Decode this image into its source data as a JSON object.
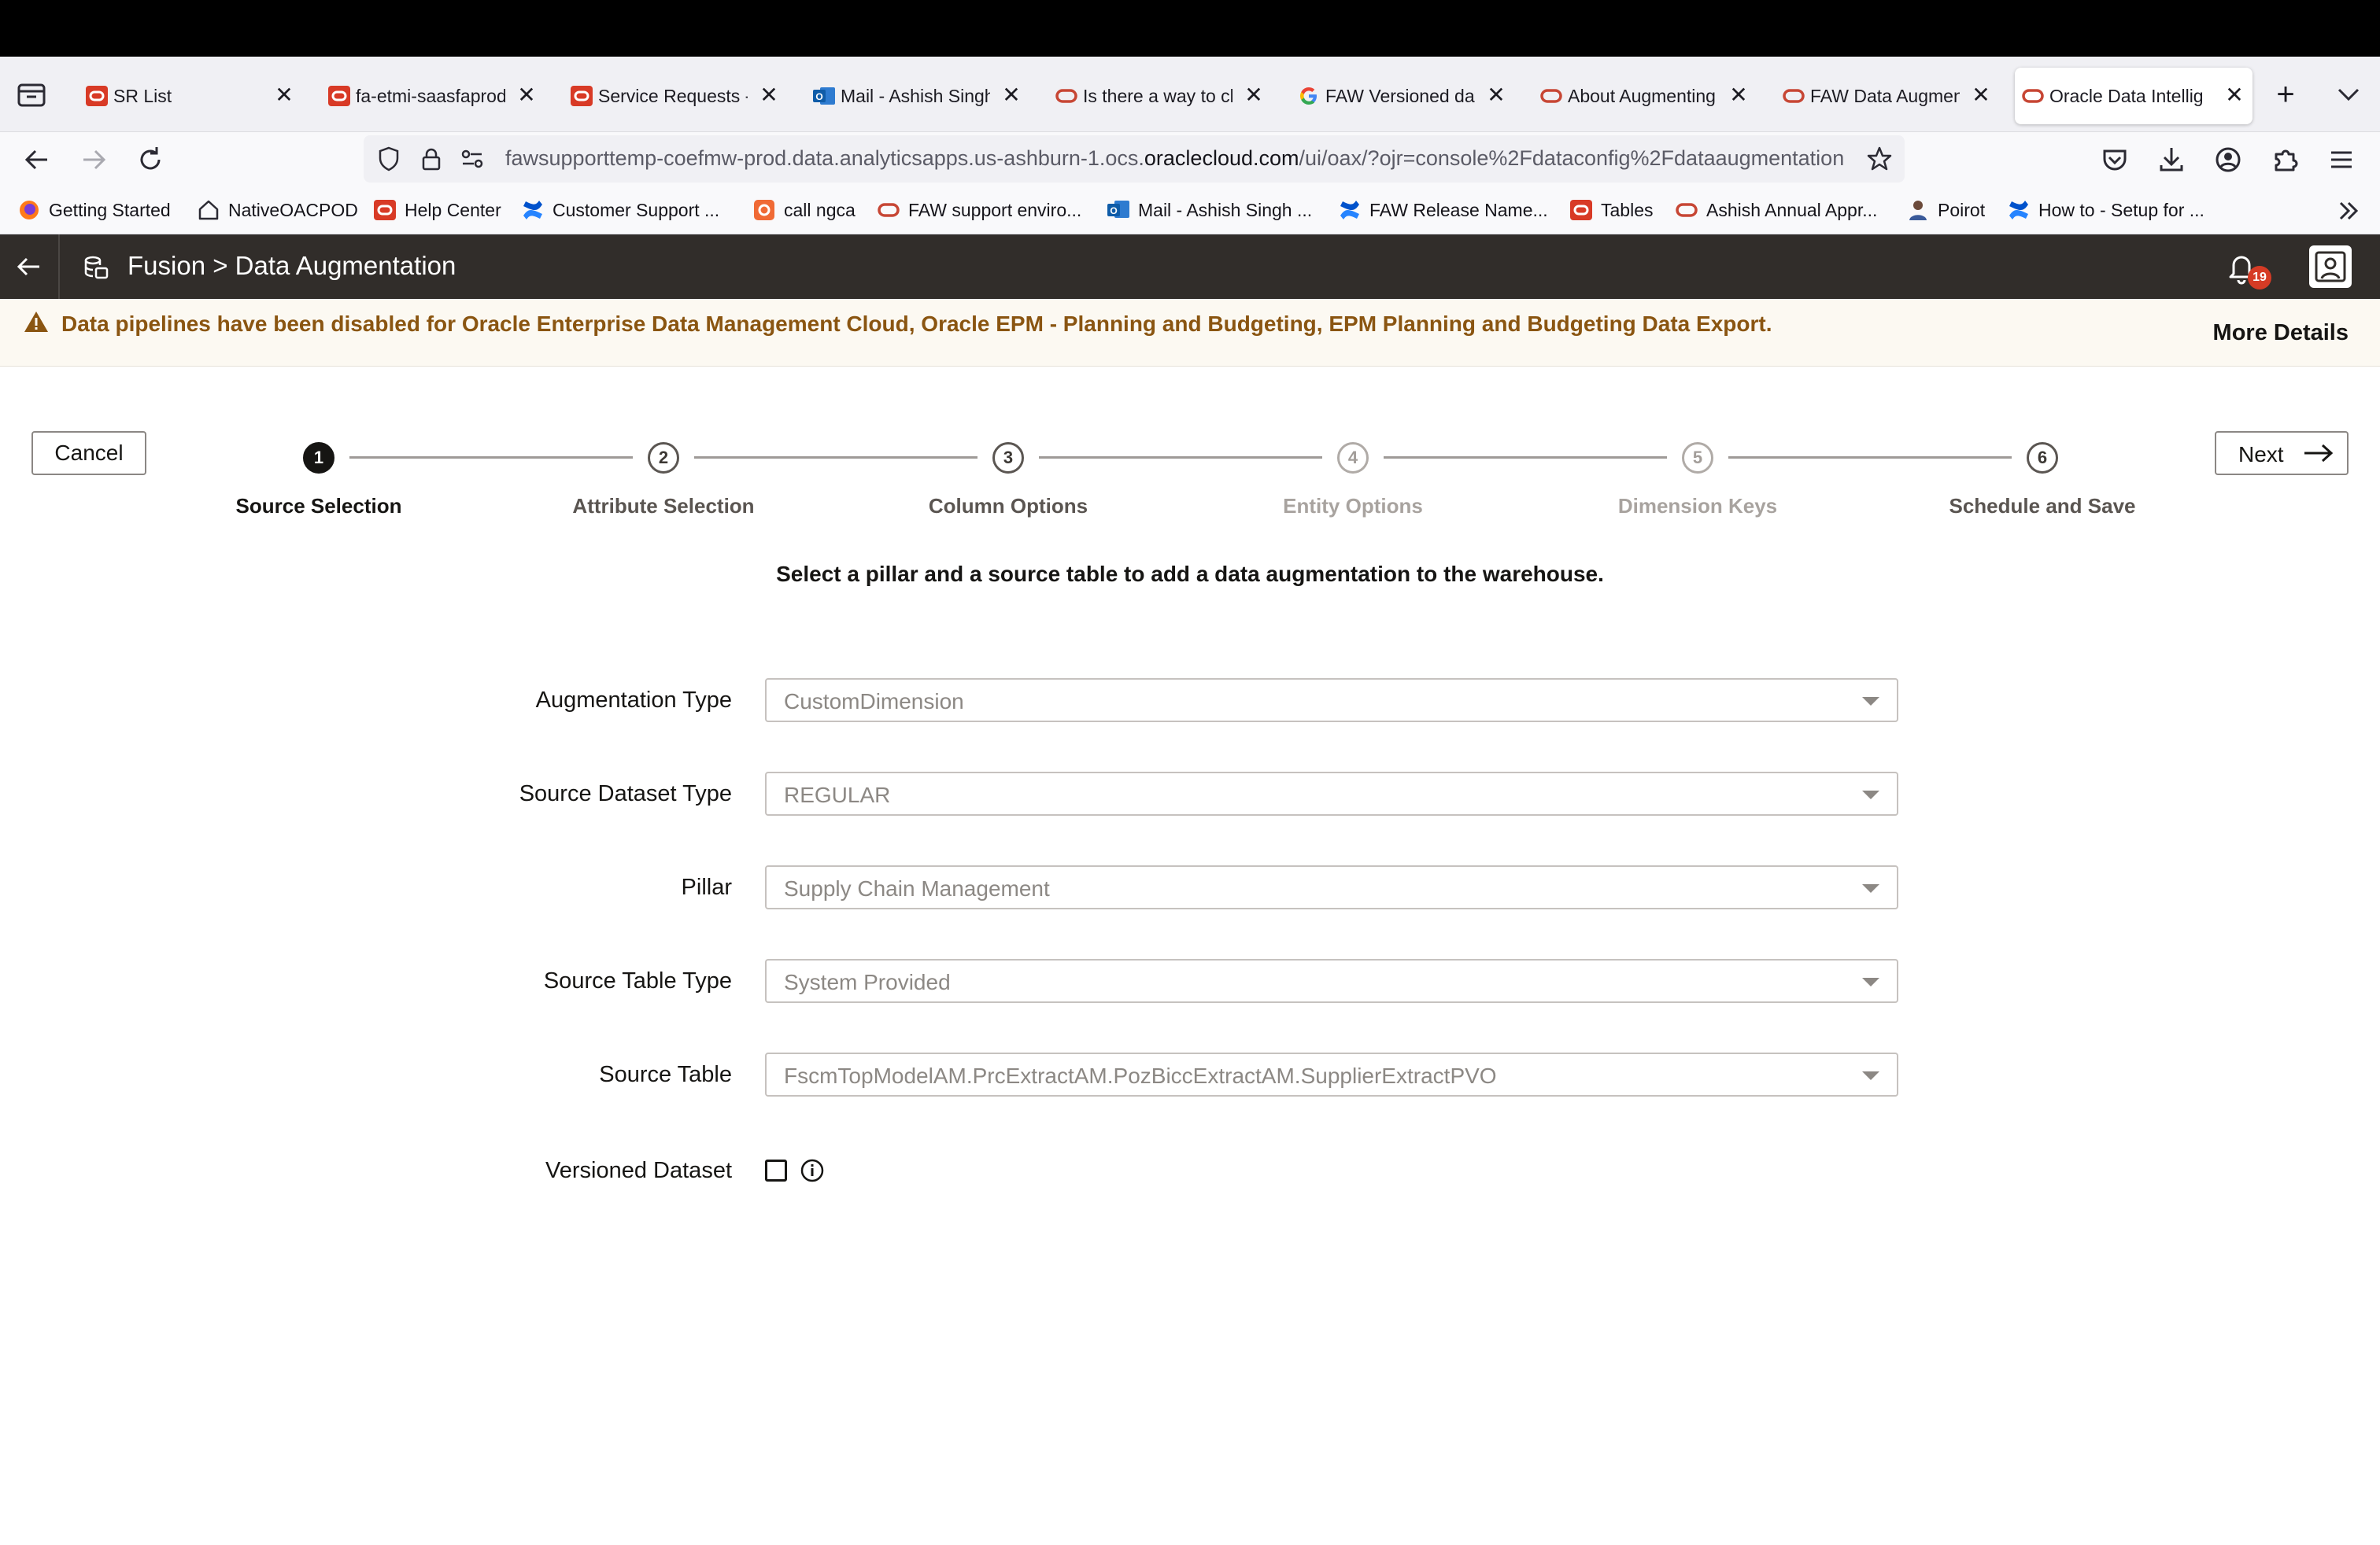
{
  "browser": {
    "tabs": [
      {
        "title": "SR List",
        "favicon": "oracle-square-icon",
        "active": false
      },
      {
        "title": "fa-etmi-saasfaprod",
        "favicon": "oracle-square-icon",
        "active": false
      },
      {
        "title": "Service Requests -",
        "favicon": "oracle-square-icon",
        "active": false
      },
      {
        "title": "Mail - Ashish Singh",
        "favicon": "outlook-icon",
        "active": false
      },
      {
        "title": "Is there a way to cl",
        "favicon": "oracle-ring-icon",
        "active": false
      },
      {
        "title": "FAW Versioned data",
        "favicon": "google-icon",
        "active": false
      },
      {
        "title": "About Augmenting",
        "favicon": "oracle-ring-icon",
        "active": false
      },
      {
        "title": "FAW Data Augmenta",
        "favicon": "oracle-ring-icon",
        "active": false
      },
      {
        "title": "Oracle Data Intellig",
        "favicon": "oracle-ring-icon",
        "active": true
      }
    ],
    "tab_close_glyph": "✕",
    "new_tab_glyph": "+",
    "url": {
      "prefix": "fawsupporttemp-coefmw-prod.data.analyticsapps.us-ashburn-1.ocs.",
      "host": "oraclecloud.com",
      "path": "/ui/oax/?ojr=console%2Fdataconfig%2Fdataaugmentation"
    },
    "bookmarks": [
      {
        "label": "Getting Started",
        "icon": "firefox-icon"
      },
      {
        "label": "NativeOACPOD",
        "icon": "home-icon"
      },
      {
        "label": "Help Center",
        "icon": "oracle-square-icon"
      },
      {
        "label": "Customer Support ...",
        "icon": "confluence-icon"
      },
      {
        "label": "call ngca",
        "icon": "app-icon"
      },
      {
        "label": "FAW support enviro...",
        "icon": "oracle-ring-icon"
      },
      {
        "label": "Mail - Ashish Singh ...",
        "icon": "outlook-icon"
      },
      {
        "label": "FAW Release Name...",
        "icon": "confluence-icon"
      },
      {
        "label": "Tables",
        "icon": "oracle-square-icon"
      },
      {
        "label": "Ashish Annual Appr...",
        "icon": "oracle-ring-icon"
      },
      {
        "label": "Poirot",
        "icon": "person-icon"
      },
      {
        "label": "How to - Setup for ...",
        "icon": "confluence-icon"
      }
    ]
  },
  "app": {
    "title": "Fusion > Data Augmentation",
    "notification_count": "19"
  },
  "banner": {
    "message": "Data pipelines have been disabled for Oracle Enterprise Data Management Cloud, Oracle EPM - Planning and Budgeting, EPM Planning and Budgeting Data Export.",
    "link": "More Details"
  },
  "wizard": {
    "cancel_label": "Cancel",
    "next_label": "Next",
    "steps": [
      {
        "number": "1",
        "label": "Source Selection",
        "state": "current"
      },
      {
        "number": "2",
        "label": "Attribute Selection",
        "state": "enabled"
      },
      {
        "number": "3",
        "label": "Column Options",
        "state": "enabled"
      },
      {
        "number": "4",
        "label": "Entity Options",
        "state": "disabled"
      },
      {
        "number": "5",
        "label": "Dimension Keys",
        "state": "disabled"
      },
      {
        "number": "6",
        "label": "Schedule and Save",
        "state": "enabled"
      }
    ],
    "instruction": "Select a pillar and a source table to add a data augmentation to the warehouse."
  },
  "form": {
    "fields": [
      {
        "label": "Augmentation Type",
        "value": "CustomDimension"
      },
      {
        "label": "Source Dataset Type",
        "value": "REGULAR"
      },
      {
        "label": "Pillar",
        "value": "Supply Chain Management"
      },
      {
        "label": "Source Table Type",
        "value": "System Provided"
      },
      {
        "label": "Source Table",
        "value": "FscmTopModelAM.PrcExtractAM.PozBiccExtractAM.SupplierExtractPVO"
      }
    ],
    "versioned_label": "Versioned Dataset",
    "versioned_checked": false
  },
  "colors": {
    "header_bg": "#312d2a",
    "banner_bg": "#fcf9f2",
    "banner_text": "#8a5511",
    "oracle_red": "#c74634"
  }
}
